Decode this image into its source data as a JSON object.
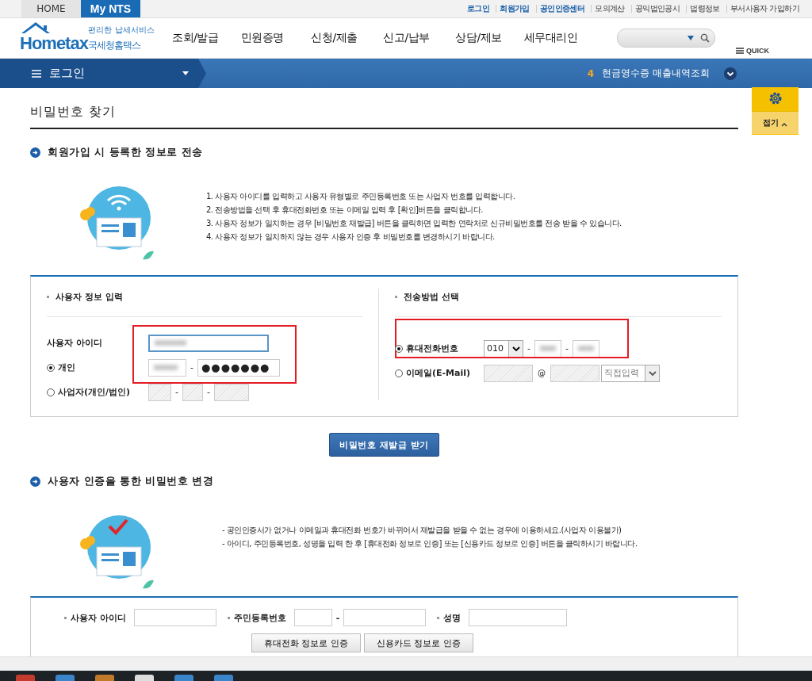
{
  "top_tabs": [
    {
      "label": "HOME",
      "selected": false
    },
    {
      "label": "My NTS",
      "selected": true
    }
  ],
  "top_links": [
    {
      "label": "로그인",
      "highlight": true
    },
    {
      "label": "회원가입",
      "highlight": true
    },
    {
      "label": "공인인증센터",
      "highlight": true
    },
    {
      "label": "모의계산",
      "highlight": false
    },
    {
      "label": "공익법인공시",
      "highlight": false
    },
    {
      "label": "법령정보",
      "highlight": false
    },
    {
      "label": "부서사용자 가입하기",
      "highlight": false
    }
  ],
  "logo": {
    "small": "편리한 납세서비스",
    "main": "Hometax",
    "sub": "국세청홈택스"
  },
  "nav": [
    "조회/발급",
    "민원증명",
    "신청/제출",
    "신고/납부",
    "상담/제보",
    "세무대리인"
  ],
  "quick_label": "QUICK",
  "menu_bar": {
    "menu": "로그인",
    "notice_number": "4",
    "notice": "현금영수증 매출내역조회"
  },
  "quick_panel": {
    "collapse": "접기"
  },
  "page_title": "비밀번호 찾기",
  "section1": {
    "title": "회원가입 시 등록한 정보로 전송",
    "steps": [
      "1. 사용자 아이디를 입력하고 사용자 유형별로 주민등록번호 또는 사업자 번호를 입력합니다.",
      "2. 전송방법을 선택 후 휴대전화번호 또는 이메일 입력 후 [확인]버튼을 클릭합니다.",
      "3. 사용자 정보가 일치하는 경우 [비밀번호 재발급] 버튼을 클릭하면 입력한 연락처로 신규비밀번호를 전송 받을 수 있습니다.",
      "4. 사용자 정보가 일치하지 않는 경우 사용자 인증 후 비밀번호를 변경하시기 바랍니다."
    ]
  },
  "user_info": {
    "title": "사용자 정보 입력",
    "id_label": "사용자 아이디",
    "options": [
      {
        "label": "개인",
        "selected": true,
        "password": "●●●●●●●",
        "separators": [
          "-"
        ]
      },
      {
        "label": "사업자(개인/법인)",
        "selected": false,
        "separators": [
          "-",
          "-"
        ]
      }
    ]
  },
  "send_method": {
    "title": "전송방법 선택",
    "options": [
      {
        "label": "휴대전화번호",
        "selected": true,
        "prefix": "010",
        "separators": [
          "-",
          "-"
        ]
      },
      {
        "label": "이메일(E-Mail)",
        "selected": false,
        "at": "@",
        "domain": "직접입력"
      }
    ]
  },
  "reissue_button": "비밀번호 재발급 받기",
  "section2": {
    "title": "사용자 인증을 통한 비밀번호 변경",
    "notes": [
      "- 공인인증서가 없거나 이메일과 휴대전화 번호가 바뀌어서 재발급을 받을 수 없는 경우에 이용하세요.(사업자 이용불가)",
      "- 아이디, 주민등록번호, 성명을 입력 한 후 [휴대전화 정보로 인증] 또는 [신용카드 정보로 인증] 버튼을 클릭하시기 바랍니다."
    ]
  },
  "verify_form": {
    "id_label": "사용자 아이디",
    "rrn_label": "주민등록번호",
    "rrn_separator": "-",
    "name_label": "성명",
    "buttons": [
      "휴대전화 정보로 인증",
      "신용카드 정보로 인증"
    ]
  }
}
